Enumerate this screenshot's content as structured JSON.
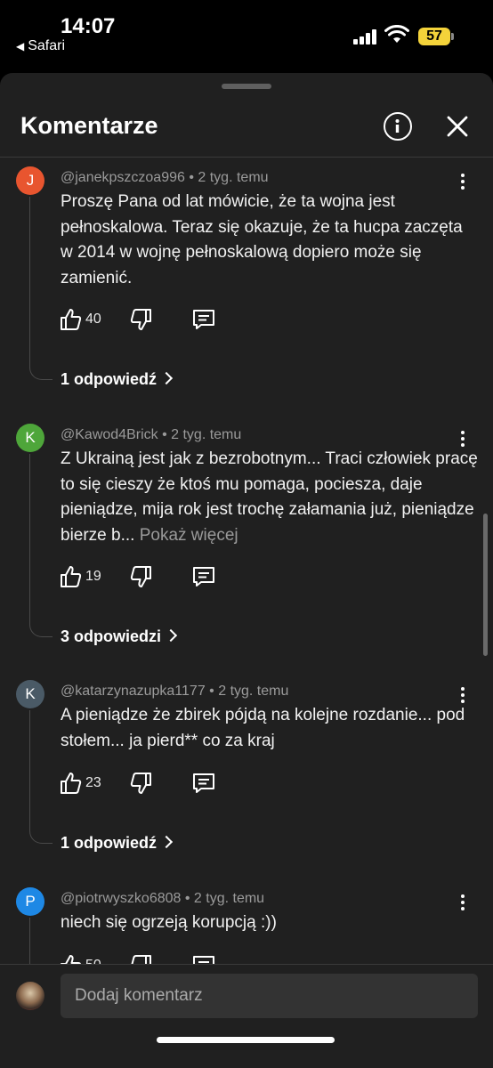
{
  "status_bar": {
    "time": "14:07",
    "back_app": "Safari",
    "battery": "57",
    "battery_color": "#f4d33a"
  },
  "sheet": {
    "title": "Komentarze",
    "info_icon": "info-icon",
    "close_icon": "close-icon"
  },
  "comments": [
    {
      "avatar_letter": "J",
      "avatar_color": "#e8552f",
      "author": "@janekpszczoa996",
      "time": "2 tyg. temu",
      "text": "Proszę Pana od lat mówicie, że ta wojna jest pełnoskalowa. Teraz się okazuje, że ta hucpa zaczęta w 2014  w wojnę pełnoskalową dopiero może się zamienić.",
      "more": "",
      "likes": "40",
      "replies": "1 odpowiedź"
    },
    {
      "avatar_letter": "K",
      "avatar_color": "#4ea63a",
      "author": "@Kawod4Brick",
      "time": "2 tyg. temu",
      "text": "Z Ukrainą jest jak z bezrobotnym... Traci człowiek pracę to się cieszy że ktoś mu pomaga, pociesza, daje pieniądze, mija rok jest trochę załamania już, pieniądze bierze b...",
      "more": "Pokaż więcej",
      "likes": "19",
      "replies": "3 odpowiedzi"
    },
    {
      "avatar_letter": "K",
      "avatar_color": "#4a5a66",
      "author": "@katarzynazupka1177",
      "time": "2 tyg. temu",
      "text": "A pieniądze że zbirek pójdą na kolejne rozdanie... pod stołem... ja pierd** co za kraj",
      "more": "",
      "likes": "23",
      "replies": "1 odpowiedź"
    },
    {
      "avatar_letter": "P",
      "avatar_color": "#1e88e5",
      "author": "@piotrwyszko6808",
      "time": "2 tyg. temu",
      "text": "niech się ogrzeją korupcją :))",
      "more": "",
      "likes": "50",
      "replies": ""
    }
  ],
  "composer": {
    "placeholder": "Dodaj komentarz"
  }
}
